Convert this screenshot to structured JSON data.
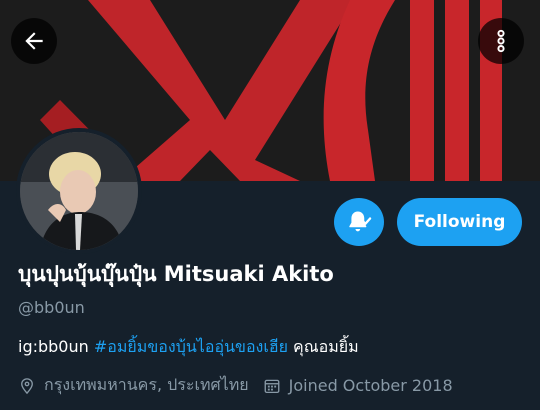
{
  "banner": {
    "text": "XCIII"
  },
  "header": {
    "back_icon": "arrow-left-icon",
    "more_icon": "vertical-ellipsis-icon"
  },
  "profile": {
    "display_name": "บุนปุนบุ้นบุ๊นปุ๋น Mitsuaki Akito",
    "handle": "@bb0un",
    "bio": {
      "prefix": "ig:bb0un ",
      "hashtag": "#อมยิ้มของบุ้นไออุ่นของเฮีย",
      "suffix": " คุณอมยิ้ม"
    },
    "location": "กรุงเทพมหานคร, ประเทศไทย",
    "joined": "Joined October 2018"
  },
  "actions": {
    "notifications_icon": "bell-check-icon",
    "follow_label": "Following"
  },
  "colors": {
    "background": "#15202b",
    "accent": "#1da1f2",
    "muted": "#8899a6",
    "banner_red": "#c8262b"
  }
}
